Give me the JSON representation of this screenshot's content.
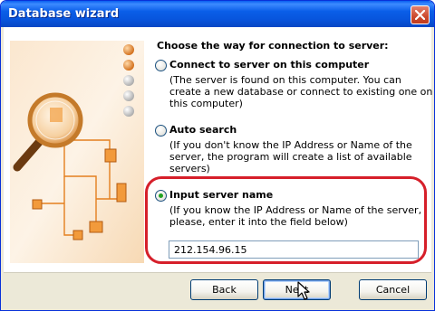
{
  "window": {
    "title": "Database wizard"
  },
  "section_title": "Choose the way for connection to server:",
  "options": [
    {
      "label": "Connect to server on this computer",
      "description": "(The server is found on this computer. You can create a new database or connect to existing one on this computer)",
      "selected": false
    },
    {
      "label": "Auto search",
      "description": "(If you don't know the IP Address or Name of the server, the program will create a list of available servers)",
      "selected": false
    },
    {
      "label": "Input server name",
      "description": "(If you know the IP Address or Name of the server, please, enter it into the field below)",
      "selected": true
    }
  ],
  "server_input": {
    "value": "212.154.96.15"
  },
  "buttons": {
    "back": "Back",
    "next": "Next",
    "cancel": "Cancel"
  },
  "colors": {
    "title_bar": "#0855dd",
    "highlight": "#d61f2a",
    "radio_selected": "#21a121",
    "art_orange": "#f29a3b"
  },
  "icons": [
    "close-icon",
    "magnifier-icon",
    "network-tree-icon",
    "step-indicator-icon",
    "mouse-cursor-icon"
  ]
}
